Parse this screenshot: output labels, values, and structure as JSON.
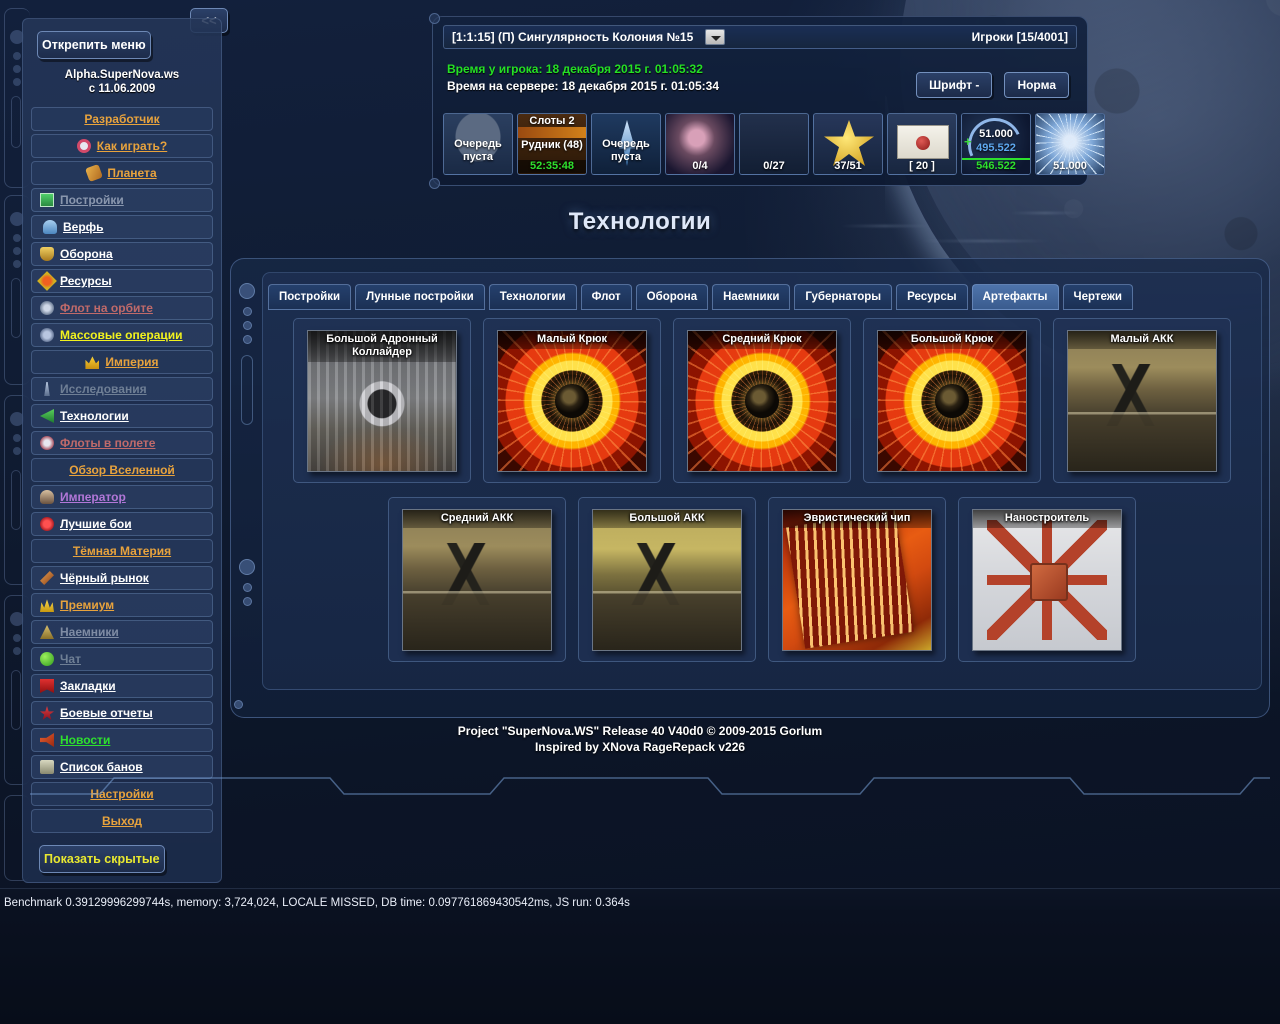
{
  "collapse_button": "<<",
  "sidebar": {
    "unpin_label": "Открепить меню",
    "site_name_line1": "Alpha.SuperNova.ws",
    "site_name_line2": "с 11.06.2009",
    "show_hidden_label": "Показать скрытые",
    "items": [
      {
        "label": "Разработчик",
        "icon": "none",
        "color": "orange",
        "center": true
      },
      {
        "label": "Как играть?",
        "icon": "ring-icon",
        "color": "orange",
        "center": true
      },
      {
        "label": "Планета",
        "icon": "planet-icon",
        "color": "orange",
        "center": true
      },
      {
        "label": "Постройки",
        "icon": "building-icon",
        "color": "dim",
        "center": false
      },
      {
        "label": "Верфь",
        "icon": "shipyard-icon",
        "color": "white",
        "center": false
      },
      {
        "label": "Оборона",
        "icon": "shield-icon",
        "color": "white",
        "center": false
      },
      {
        "label": "Ресурсы",
        "icon": "resources-icon",
        "color": "white",
        "center": false
      },
      {
        "label": "Флот на орбите",
        "icon": "fleet-icon",
        "color": "red",
        "center": false
      },
      {
        "label": "Массовые операции",
        "icon": "mass-ops-icon",
        "color": "yellow",
        "center": false
      },
      {
        "label": "Империя",
        "icon": "crown-icon",
        "color": "orange",
        "center": true
      },
      {
        "label": "Исследования",
        "icon": "research-icon",
        "color": "dimg",
        "center": false
      },
      {
        "label": "Технологии",
        "icon": "tech-icon",
        "color": "white",
        "center": false
      },
      {
        "label": "Флоты в полете",
        "icon": "flights-icon",
        "color": "red",
        "center": false
      },
      {
        "label": "Обзор Вселенной",
        "icon": "none",
        "color": "orange",
        "center": true
      },
      {
        "label": "Император",
        "icon": "emperor-icon",
        "color": "purple",
        "center": false
      },
      {
        "label": "Лучшие бои",
        "icon": "battles-icon",
        "color": "white",
        "center": false
      },
      {
        "label": "Тёмная Материя",
        "icon": "none",
        "color": "orange",
        "center": true
      },
      {
        "label": "Чёрный рынок",
        "icon": "market-icon",
        "color": "white",
        "center": false
      },
      {
        "label": "Премиум",
        "icon": "premium-icon",
        "color": "orange",
        "center": false
      },
      {
        "label": "Наемники",
        "icon": "mercenary-icon",
        "color": "gray",
        "center": false
      },
      {
        "label": "Чат",
        "icon": "chat-icon",
        "color": "dimg",
        "center": false
      },
      {
        "label": "Закладки",
        "icon": "bookmark-icon",
        "color": "white",
        "center": false
      },
      {
        "label": "Боевые отчеты",
        "icon": "report-icon",
        "color": "white",
        "center": false
      },
      {
        "label": "Новости",
        "icon": "news-icon",
        "color": "green",
        "center": false
      },
      {
        "label": "Список банов",
        "icon": "lock-icon",
        "color": "white",
        "center": false
      },
      {
        "label": "Настройки",
        "icon": "none",
        "color": "orange",
        "center": true
      },
      {
        "label": "Выход",
        "icon": "none",
        "color": "orange",
        "center": true
      }
    ]
  },
  "top_panel": {
    "planet_selector": "[1:1:15] (П) Сингулярность Колония №15",
    "players_count": "Игроки [15/4001]",
    "player_time": "Время у игрока: 18 декабря 2015 г. 01:05:32",
    "server_time": "Время на сервере: 18 декабря 2015 г. 01:05:34",
    "font_button": "Шрифт -",
    "norm_button": "Норма",
    "resources": [
      {
        "name": "build-queue",
        "icon": "building-icon",
        "line1": "Очередь",
        "line2": "пуста",
        "value": ""
      },
      {
        "name": "mine-slots",
        "icon": "mine-icon",
        "line1": "Слоты 2",
        "line2": "Рудник (48)",
        "value": "52:35:48"
      },
      {
        "name": "ship-queue",
        "icon": "ship-icon",
        "line1": "Очередь",
        "line2": "пуста",
        "value": ""
      },
      {
        "name": "debris-field",
        "icon": "debris-icon",
        "line1": "",
        "line2": "",
        "value": "0/4"
      },
      {
        "name": "fleet-slots",
        "icon": "fleet-icon",
        "line1": "",
        "line2": "",
        "value": "0/27"
      },
      {
        "name": "officers",
        "icon": "star-icon",
        "line1": "",
        "line2": "",
        "value": "37/51"
      },
      {
        "name": "messages",
        "icon": "envelope-icon",
        "line1": "",
        "line2": "",
        "value": "[ 20 ]"
      },
      {
        "name": "dark-matter",
        "icon": "darkmatter-icon",
        "line1": "51.000",
        "line2": "495.522",
        "value": "546.522"
      },
      {
        "name": "crystal",
        "icon": "crystal-icon",
        "line1": "",
        "line2": "",
        "value": "51.000"
      }
    ]
  },
  "page_title": "Технологии",
  "tabs": [
    {
      "label": "Постройки",
      "active": false
    },
    {
      "label": "Лунные постройки",
      "active": false
    },
    {
      "label": "Технологии",
      "active": false
    },
    {
      "label": "Флот",
      "active": false
    },
    {
      "label": "Оборона",
      "active": false
    },
    {
      "label": "Наемники",
      "active": false
    },
    {
      "label": "Губернаторы",
      "active": false
    },
    {
      "label": "Ресурсы",
      "active": false
    },
    {
      "label": "Артефакты",
      "active": true
    },
    {
      "label": "Чертежи",
      "active": false
    }
  ],
  "cards": {
    "row1": [
      {
        "title": "Большой Адронный Коллайдер",
        "art": "lhc"
      },
      {
        "title": "Малый Крюк",
        "art": "hook"
      },
      {
        "title": "Средний Крюк",
        "art": "hook"
      },
      {
        "title": "Большой Крюк",
        "art": "hook"
      },
      {
        "title": "Малый АКК",
        "art": "akk"
      }
    ],
    "row2": [
      {
        "title": "Средний АКК",
        "art": "akk"
      },
      {
        "title": "Большой АКК",
        "art": "akk-gold"
      },
      {
        "title": "Эвристический чип",
        "art": "chip"
      },
      {
        "title": "Наностроитель",
        "art": "nano"
      }
    ]
  },
  "footer": {
    "line1": "Project \"SuperNova.WS\" Release 40 V40d0 © 2009-2015 Gorlum",
    "line2": "Inspired by XNova RageRepack v226"
  },
  "benchmark": "Benchmark 0.39129996299744s, memory: 3,724,024, LOCALE MISSED, DB time: 0.097761869430542ms, JS run: 0.364s",
  "colors": {
    "accent_orange": "#e8a33d",
    "accent_yellow": "#f2f21e",
    "accent_green": "#25e025",
    "panel_blue": "#1b3053",
    "tab_active": "#4e74ab"
  }
}
